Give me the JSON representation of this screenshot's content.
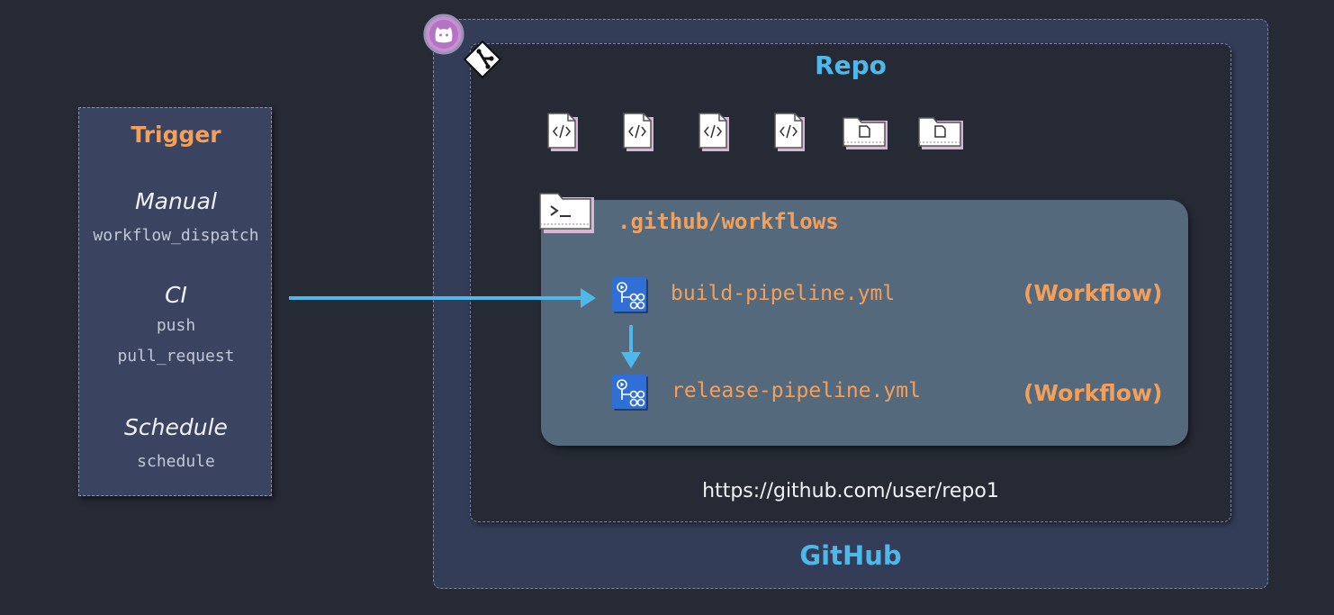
{
  "trigger": {
    "title": "Trigger",
    "groups": [
      {
        "heading": "Manual",
        "events": [
          "workflow_dispatch"
        ]
      },
      {
        "heading": "CI",
        "events": [
          "push",
          "pull_request"
        ]
      },
      {
        "heading": "Schedule",
        "events": [
          "schedule"
        ]
      }
    ]
  },
  "github": {
    "label": "GitHub",
    "repo": {
      "label": "Repo",
      "url": "https://github.com/user/repo1",
      "files": [
        "code-file-icon",
        "code-file-icon",
        "code-file-icon",
        "code-file-icon",
        "document-folder-icon",
        "document-folder-icon"
      ],
      "workflows_folder": {
        "name": ".github/workflows",
        "icon": "terminal-folder-icon",
        "items": [
          {
            "file": "build-pipeline.yml",
            "tag": "(Workflow)"
          },
          {
            "file": "release-pipeline.yml",
            "tag": "(Workflow)"
          }
        ]
      }
    }
  },
  "colors": {
    "accent_orange": "#f5a05a",
    "accent_blue": "#4fb8ea",
    "background": "#262a35",
    "panel": "#3a4461",
    "workflow_box": "#55697c",
    "action_icon": "#2f6fd6"
  }
}
